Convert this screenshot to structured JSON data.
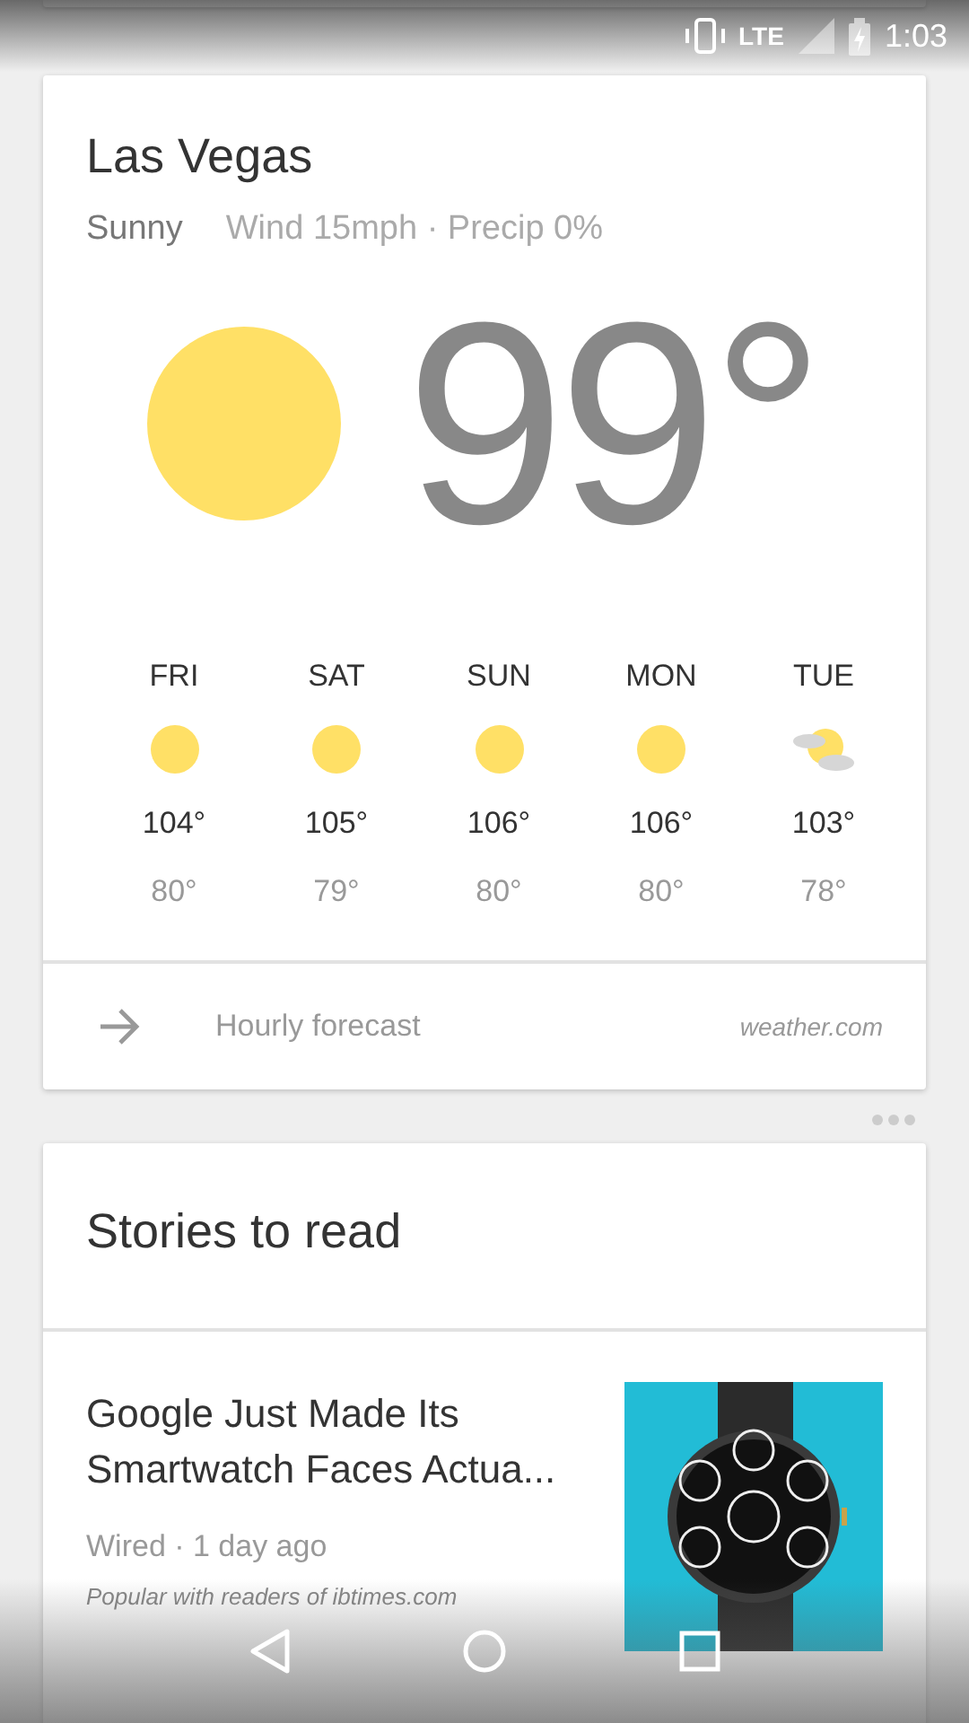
{
  "status_bar": {
    "network": "LTE",
    "time": "1:03"
  },
  "weather": {
    "city": "Las Vegas",
    "condition": "Sunny",
    "details": "Wind 15mph · Precip 0%",
    "temperature": "99°",
    "kind": "sunny",
    "forecast": [
      {
        "day": "FRI",
        "kind": "sunny",
        "high": "104°",
        "low": "80°"
      },
      {
        "day": "SAT",
        "kind": "sunny",
        "high": "105°",
        "low": "79°"
      },
      {
        "day": "SUN",
        "kind": "sunny",
        "high": "106°",
        "low": "80°"
      },
      {
        "day": "MON",
        "kind": "sunny",
        "high": "106°",
        "low": "80°"
      },
      {
        "day": "TUE",
        "kind": "partly-cloudy",
        "high": "103°",
        "low": "78°"
      }
    ],
    "link": "Hourly forecast",
    "source": "weather.com"
  },
  "stories": {
    "title": "Stories to read",
    "items": [
      {
        "headline": "Google Just Made Its Smartwatch Faces Actua...",
        "meta": "Wired · 1 day ago",
        "note": "Popular with readers of ibtimes.com"
      }
    ]
  }
}
